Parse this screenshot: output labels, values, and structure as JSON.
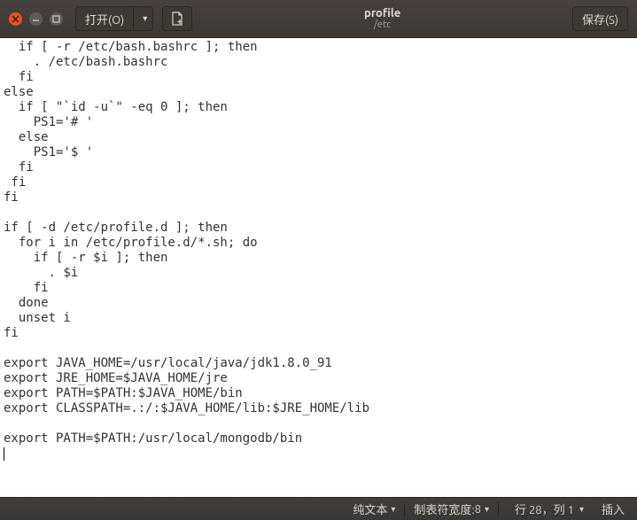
{
  "titlebar": {
    "open_label": "打开(O)",
    "save_label": "保存(S)",
    "title": "profile",
    "subtitle": "/etc"
  },
  "editor": {
    "content": "  if [ -r /etc/bash.bashrc ]; then\n    . /etc/bash.bashrc\n  fi\nelse\n  if [ \"`id -u`\" -eq 0 ]; then\n    PS1='# '\n  else\n    PS1='$ '\n  fi\n fi\nfi\n\nif [ -d /etc/profile.d ]; then\n  for i in /etc/profile.d/*.sh; do\n    if [ -r $i ]; then\n      . $i\n    fi\n  done\n  unset i\nfi\n\nexport JAVA_HOME=/usr/local/java/jdk1.8.0_91\nexport JRE_HOME=$JAVA_HOME/jre\nexport PATH=$PATH:$JAVA_HOME/bin\nexport CLASSPATH=.:/:$JAVA_HOME/lib:$JRE_HOME/lib\n\nexport PATH=$PATH:/usr/local/mongodb/bin\n"
  },
  "statusbar": {
    "syntax": "纯文本",
    "tab_label": "制表符宽度: ",
    "tab_value": "8",
    "position": "行 28，列 1",
    "insert_mode": "插入"
  }
}
